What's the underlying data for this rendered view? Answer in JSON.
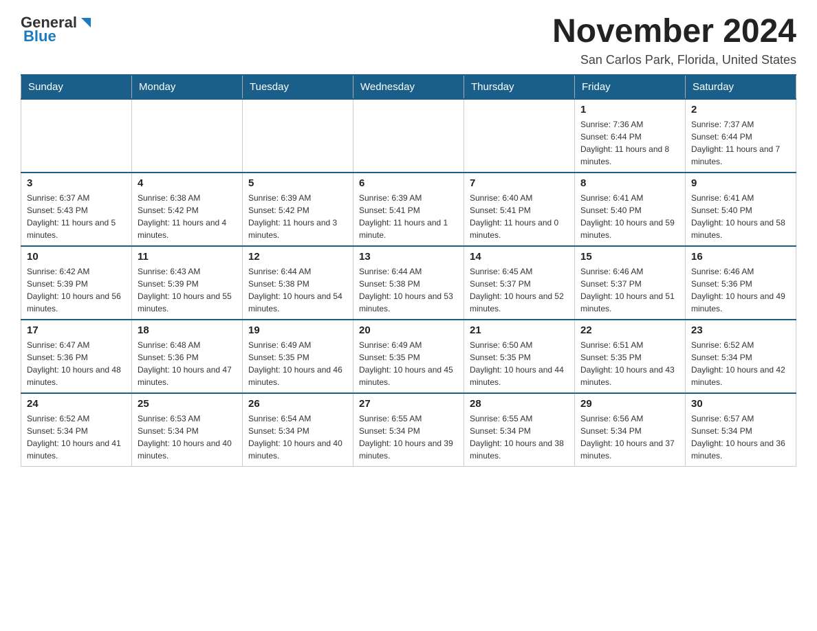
{
  "header": {
    "logo_general": "General",
    "logo_blue": "Blue",
    "month_title": "November 2024",
    "location": "San Carlos Park, Florida, United States"
  },
  "days_of_week": [
    "Sunday",
    "Monday",
    "Tuesday",
    "Wednesday",
    "Thursday",
    "Friday",
    "Saturday"
  ],
  "weeks": [
    [
      {
        "day": "",
        "info": ""
      },
      {
        "day": "",
        "info": ""
      },
      {
        "day": "",
        "info": ""
      },
      {
        "day": "",
        "info": ""
      },
      {
        "day": "",
        "info": ""
      },
      {
        "day": "1",
        "info": "Sunrise: 7:36 AM\nSunset: 6:44 PM\nDaylight: 11 hours and 8 minutes."
      },
      {
        "day": "2",
        "info": "Sunrise: 7:37 AM\nSunset: 6:44 PM\nDaylight: 11 hours and 7 minutes."
      }
    ],
    [
      {
        "day": "3",
        "info": "Sunrise: 6:37 AM\nSunset: 5:43 PM\nDaylight: 11 hours and 5 minutes."
      },
      {
        "day": "4",
        "info": "Sunrise: 6:38 AM\nSunset: 5:42 PM\nDaylight: 11 hours and 4 minutes."
      },
      {
        "day": "5",
        "info": "Sunrise: 6:39 AM\nSunset: 5:42 PM\nDaylight: 11 hours and 3 minutes."
      },
      {
        "day": "6",
        "info": "Sunrise: 6:39 AM\nSunset: 5:41 PM\nDaylight: 11 hours and 1 minute."
      },
      {
        "day": "7",
        "info": "Sunrise: 6:40 AM\nSunset: 5:41 PM\nDaylight: 11 hours and 0 minutes."
      },
      {
        "day": "8",
        "info": "Sunrise: 6:41 AM\nSunset: 5:40 PM\nDaylight: 10 hours and 59 minutes."
      },
      {
        "day": "9",
        "info": "Sunrise: 6:41 AM\nSunset: 5:40 PM\nDaylight: 10 hours and 58 minutes."
      }
    ],
    [
      {
        "day": "10",
        "info": "Sunrise: 6:42 AM\nSunset: 5:39 PM\nDaylight: 10 hours and 56 minutes."
      },
      {
        "day": "11",
        "info": "Sunrise: 6:43 AM\nSunset: 5:39 PM\nDaylight: 10 hours and 55 minutes."
      },
      {
        "day": "12",
        "info": "Sunrise: 6:44 AM\nSunset: 5:38 PM\nDaylight: 10 hours and 54 minutes."
      },
      {
        "day": "13",
        "info": "Sunrise: 6:44 AM\nSunset: 5:38 PM\nDaylight: 10 hours and 53 minutes."
      },
      {
        "day": "14",
        "info": "Sunrise: 6:45 AM\nSunset: 5:37 PM\nDaylight: 10 hours and 52 minutes."
      },
      {
        "day": "15",
        "info": "Sunrise: 6:46 AM\nSunset: 5:37 PM\nDaylight: 10 hours and 51 minutes."
      },
      {
        "day": "16",
        "info": "Sunrise: 6:46 AM\nSunset: 5:36 PM\nDaylight: 10 hours and 49 minutes."
      }
    ],
    [
      {
        "day": "17",
        "info": "Sunrise: 6:47 AM\nSunset: 5:36 PM\nDaylight: 10 hours and 48 minutes."
      },
      {
        "day": "18",
        "info": "Sunrise: 6:48 AM\nSunset: 5:36 PM\nDaylight: 10 hours and 47 minutes."
      },
      {
        "day": "19",
        "info": "Sunrise: 6:49 AM\nSunset: 5:35 PM\nDaylight: 10 hours and 46 minutes."
      },
      {
        "day": "20",
        "info": "Sunrise: 6:49 AM\nSunset: 5:35 PM\nDaylight: 10 hours and 45 minutes."
      },
      {
        "day": "21",
        "info": "Sunrise: 6:50 AM\nSunset: 5:35 PM\nDaylight: 10 hours and 44 minutes."
      },
      {
        "day": "22",
        "info": "Sunrise: 6:51 AM\nSunset: 5:35 PM\nDaylight: 10 hours and 43 minutes."
      },
      {
        "day": "23",
        "info": "Sunrise: 6:52 AM\nSunset: 5:34 PM\nDaylight: 10 hours and 42 minutes."
      }
    ],
    [
      {
        "day": "24",
        "info": "Sunrise: 6:52 AM\nSunset: 5:34 PM\nDaylight: 10 hours and 41 minutes."
      },
      {
        "day": "25",
        "info": "Sunrise: 6:53 AM\nSunset: 5:34 PM\nDaylight: 10 hours and 40 minutes."
      },
      {
        "day": "26",
        "info": "Sunrise: 6:54 AM\nSunset: 5:34 PM\nDaylight: 10 hours and 40 minutes."
      },
      {
        "day": "27",
        "info": "Sunrise: 6:55 AM\nSunset: 5:34 PM\nDaylight: 10 hours and 39 minutes."
      },
      {
        "day": "28",
        "info": "Sunrise: 6:55 AM\nSunset: 5:34 PM\nDaylight: 10 hours and 38 minutes."
      },
      {
        "day": "29",
        "info": "Sunrise: 6:56 AM\nSunset: 5:34 PM\nDaylight: 10 hours and 37 minutes."
      },
      {
        "day": "30",
        "info": "Sunrise: 6:57 AM\nSunset: 5:34 PM\nDaylight: 10 hours and 36 minutes."
      }
    ]
  ]
}
